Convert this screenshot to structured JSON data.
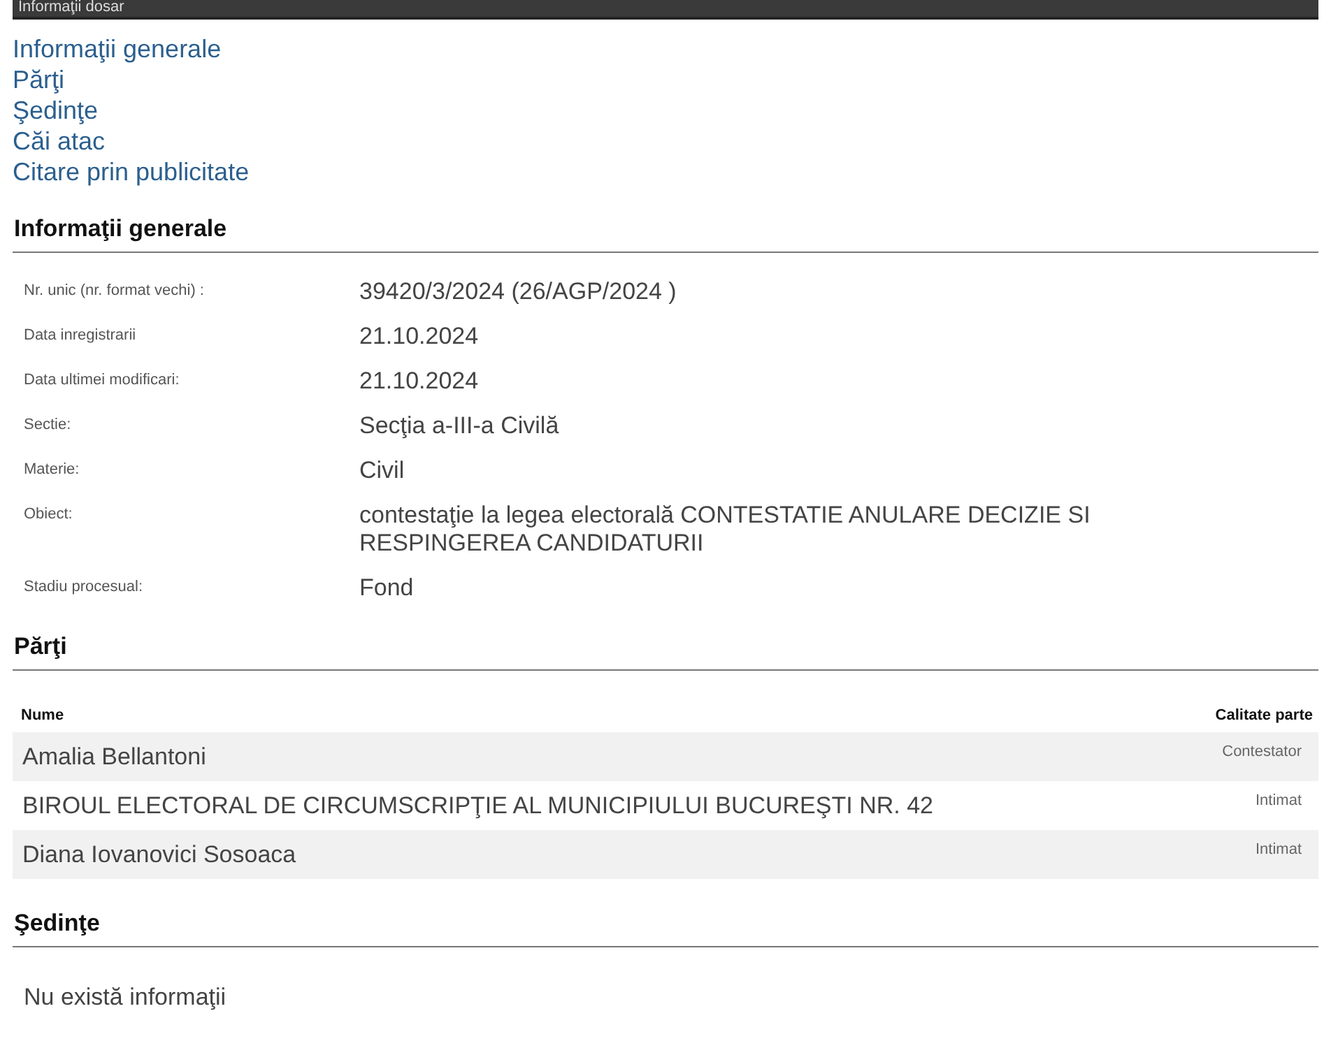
{
  "header": {
    "title": "Informaţii dosar"
  },
  "nav_links": [
    "Informaţii generale",
    "Părţi",
    "Şedinţe",
    "Căi atac",
    "Citare prin publicitate"
  ],
  "general": {
    "heading": "Informaţii generale",
    "fields": [
      {
        "label": "Nr. unic (nr. format vechi) :",
        "value": "39420/3/2024 (26/AGP/2024 )"
      },
      {
        "label": "Data inregistrarii",
        "value": "21.10.2024"
      },
      {
        "label": "Data ultimei modificari:",
        "value": "21.10.2024"
      },
      {
        "label": "Sectie:",
        "value": "Secţia a-III-a Civilă"
      },
      {
        "label": "Materie:",
        "value": "Civil"
      },
      {
        "label": "Obiect:",
        "value": "contestaţie la legea electorală CONTESTATIE ANULARE DECIZIE SI RESPINGEREA CANDIDATURII"
      },
      {
        "label": "Stadiu procesual:",
        "value": "Fond"
      }
    ]
  },
  "parties": {
    "heading": "Părţi",
    "columns": [
      "Nume",
      "Calitate parte"
    ],
    "rows": [
      {
        "name": "Amalia Bellantoni",
        "role": "Contestator"
      },
      {
        "name": "BIROUL ELECTORAL DE CIRCUMSCRIPŢIE AL MUNICIPIULUI BUCUREŞTI NR. 42",
        "role": "Intimat"
      },
      {
        "name": "Diana Iovanovici Sosoaca",
        "role": "Intimat"
      }
    ]
  },
  "hearings": {
    "heading": "Şedinţe",
    "message": "Nu există informaţii"
  }
}
